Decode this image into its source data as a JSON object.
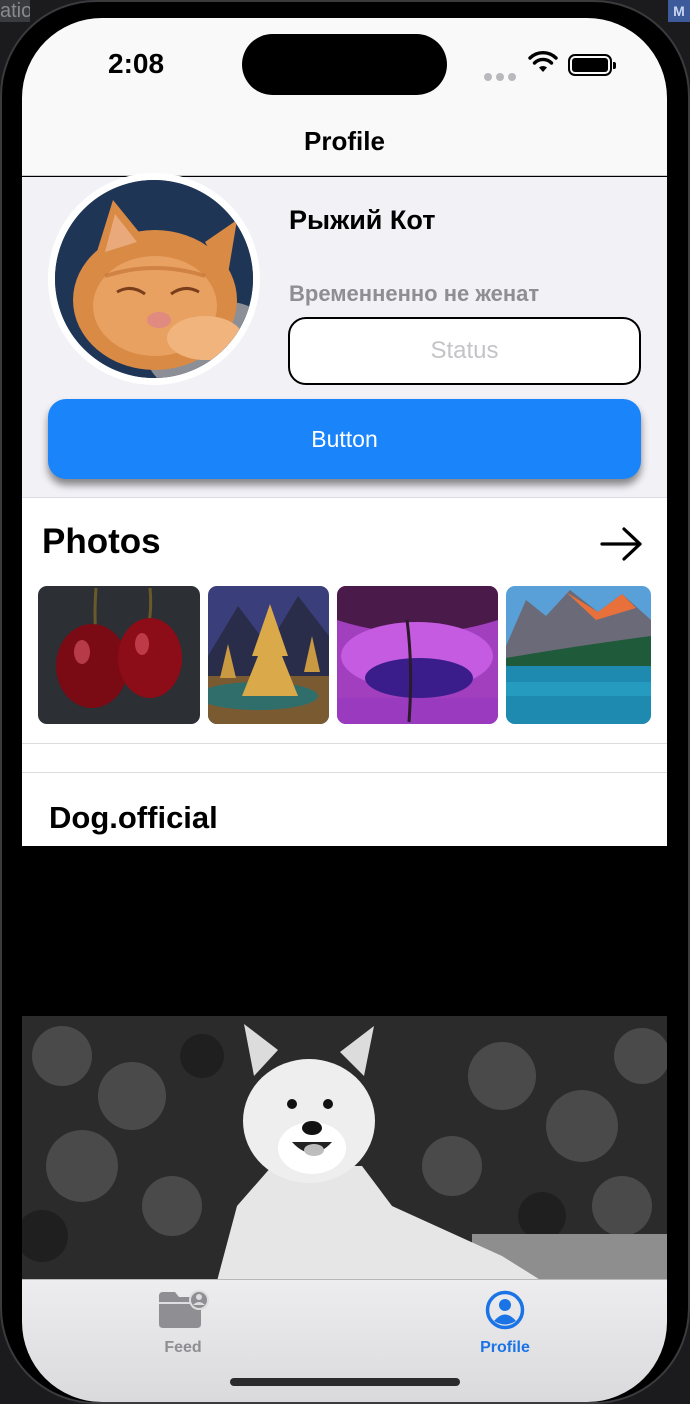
{
  "device": {
    "time": "2:08"
  },
  "background": {
    "left_text": "atio",
    "right_badge": "M"
  },
  "navbar": {
    "title": "Profile"
  },
  "profile": {
    "name": "Рыжий Кот",
    "status": "Временненно не женат",
    "status_placeholder": "Status",
    "button_label": "Button",
    "avatar_description": "orange-cat-avatar"
  },
  "photos": {
    "title": "Photos",
    "items": [
      {
        "name": "photo-cherries"
      },
      {
        "name": "photo-glowing-trees"
      },
      {
        "name": "photo-purple-lake"
      },
      {
        "name": "photo-mountain-lake"
      }
    ]
  },
  "post": {
    "author": "Dog.official",
    "image": "akita-dog-photo"
  },
  "tabbar": {
    "items": [
      {
        "label": "Feed",
        "icon": "folder-person-icon",
        "active": false
      },
      {
        "label": "Profile",
        "icon": "person-circle-icon",
        "active": true
      }
    ]
  },
  "colors": {
    "accent": "#1a84fb",
    "tab_active": "#1a74e6",
    "tab_inactive": "#8e8e93"
  }
}
